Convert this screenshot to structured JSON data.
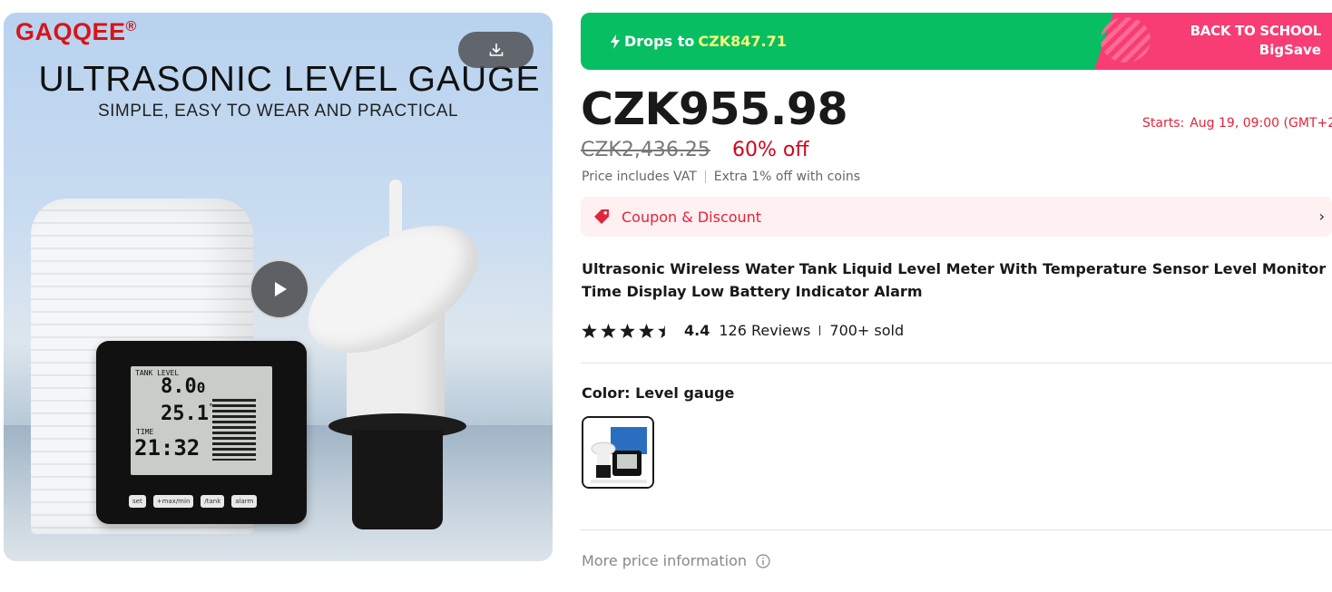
{
  "media": {
    "brand": "GAQQEE",
    "brand_mark": "®",
    "headline": "ULTRASONIC LEVEL GAUGE",
    "subline": "SIMPLE, EASY TO WEAR AND PRACTICAL",
    "lcd": {
      "tank_level_label": "TANK LEVEL",
      "level_value": "8.0",
      "level_unit": "0",
      "temp_value": "25.1",
      "temp_unit": "°C",
      "time_label": "TIME",
      "time_value": "21:32"
    },
    "keys": [
      "set",
      "+max/min",
      "/tank",
      "alarm"
    ]
  },
  "promo": {
    "drops_label": "Drops to",
    "drops_amount": "CZK847.71",
    "event_line1": "BACK TO SCHOOL",
    "event_line2": "BigSave",
    "colors": {
      "green": "#07be62",
      "pink": "#f73d74",
      "amount": "#fffa79"
    }
  },
  "pricing": {
    "price": "CZK955.98",
    "original_price": "CZK2,436.25",
    "discount": "60% off",
    "starts_label": "Starts:",
    "starts_time": "Aug 19, 09:00 (GMT+2",
    "vat_note": "Price includes VAT",
    "coins_note": "Extra 1% off with coins"
  },
  "coupon": {
    "label": "Coupon & Discount",
    "chevron": "›"
  },
  "product": {
    "title_line1": "Ultrasonic Wireless Water Tank Liquid Level Meter With Temperature Sensor Level Monitor",
    "title_line2": "Time Display Low Battery Indicator Alarm",
    "rating_value": "4.4",
    "rating_stars": 4.4,
    "reviews": "126 Reviews",
    "sold": "700+ sold"
  },
  "variant": {
    "color_label": "Color: Level gauge"
  },
  "more_price_info": "More price information"
}
